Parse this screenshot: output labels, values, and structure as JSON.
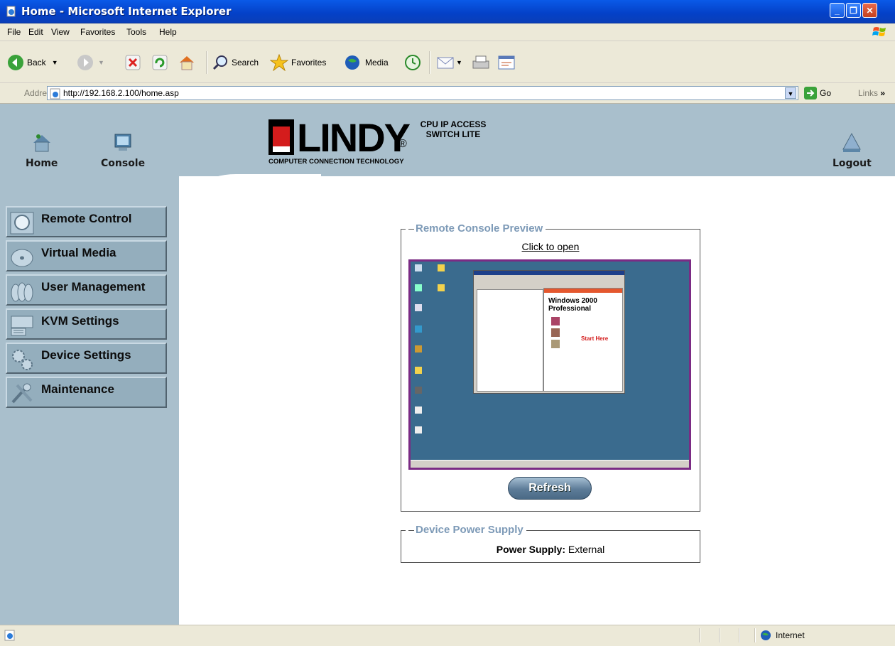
{
  "window": {
    "title": "Home - Microsoft Internet Explorer"
  },
  "menu": [
    "File",
    "Edit",
    "View",
    "Favorites",
    "Tools",
    "Help"
  ],
  "toolbar": {
    "back": "Back",
    "search": "Search",
    "favorites": "Favorites",
    "media": "Media"
  },
  "address": {
    "label": "Address",
    "url": "http://192.168.2.100/home.asp",
    "go": "Go",
    "links": "Links"
  },
  "header": {
    "nav": {
      "home": "Home",
      "console": "Console",
      "logout": "Logout"
    },
    "logo": {
      "brand": "LINDY",
      "tagline": "COMPUTER CONNECTION TECHNOLOGY",
      "product": "CPU IP ACCESS SWITCH LITE",
      "reg": "®"
    }
  },
  "sidebar": {
    "items": [
      {
        "label": "Remote Control",
        "icon": "magnifier-icon"
      },
      {
        "label": "Virtual Media",
        "icon": "disc-icon"
      },
      {
        "label": "User Management",
        "icon": "users-icon"
      },
      {
        "label": "KVM Settings",
        "icon": "keyboard-icon"
      },
      {
        "label": "Device Settings",
        "icon": "gears-icon"
      },
      {
        "label": "Maintenance",
        "icon": "tools-icon"
      }
    ]
  },
  "preview": {
    "title": "Remote Console Preview",
    "open_link": "Click to open",
    "refresh": "Refresh",
    "screen": {
      "window_heading": "Windows 2000 Professional",
      "start_here": "Start Here"
    }
  },
  "power": {
    "title": "Device Power Supply",
    "label": "Power Supply:",
    "value": "External"
  },
  "status": {
    "zone": "Internet"
  },
  "colors": {
    "sidebar": "#a9bfcc",
    "legend": "#7d9ab7",
    "titlebar": "#0a5ae8"
  }
}
